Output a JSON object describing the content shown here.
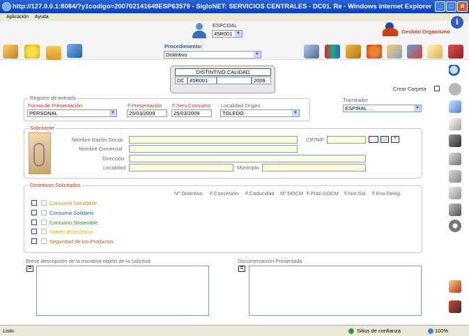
{
  "window": {
    "title": "http://127.0.0.1:8084/?y1codigo=200702141649ESP63579 - SigloNET: SERVICIOS CENTRALES - DC01. Re - Windows Internet Explorer",
    "min": "_",
    "max": "□",
    "close": "✕"
  },
  "menu": {
    "items": [
      {
        "label": "Aplicación"
      },
      {
        "label": "Ayuda"
      }
    ]
  },
  "header": {
    "user_label": "ESPCOAL",
    "user_select": "45R001",
    "procedimiento_label": "Procedimiento:",
    "procedimiento_value": "Distintivo",
    "brand": "Gestión Organismo",
    "help": "i"
  },
  "distintivo": {
    "title": "DISTINTIVO CALIDAD",
    "code1": "DC",
    "code2": "45R001",
    "code3": "",
    "code4": "2009"
  },
  "crear_carpeta": "Crear Carpeta",
  "registro": {
    "legend": "Registro de entrada",
    "forma_label": "Forma de Presentación",
    "forma_value": "PERSONAL",
    "fpres_label": "F.Presentación",
    "fpres_value": "25/03/2009",
    "fserv_label": "F.Serv.Consumo",
    "fserv_value": "25/03/2009",
    "loc_label": "Localidad Origen",
    "loc_value": "TOLEDO"
  },
  "tramitador": {
    "label": "Tramitador",
    "value": "ESPIRAL . ."
  },
  "solicitante": {
    "legend": "Solicitante",
    "nombre_label": "Nombre Razón Social",
    "cif_label": "CIF/NIF",
    "comercial_label": "Nombre Comercial",
    "direccion_label": "Dirección",
    "localidad_label": "Localidad",
    "municipio_label": "Municipio"
  },
  "distintivos": {
    "legend": "Distintivos Solicitados",
    "columns": [
      "Nº Distintivo",
      "F.Concesión",
      "F.Caducidad",
      "Nº DOCM",
      "F.Publ.DOCM",
      "F.Not.Sol.",
      "F.Env.Deleg."
    ],
    "items": [
      {
        "label": "Consumo Saludable",
        "color": "#d88a1a"
      },
      {
        "label": "Consumo Solidario",
        "color": "#1e5aa8"
      },
      {
        "label": "Consumo Sostenible",
        "color": "#2a8a2a"
      },
      {
        "label": "Interés Económico",
        "color": "#e0b000"
      },
      {
        "label": "Seguridad de los Productos",
        "color": "#c06020"
      }
    ]
  },
  "breve_label": "Breve descripción de la iniciativa objeto de la solicitud",
  "doc_label": "Documentación Presentada",
  "status": {
    "left": "Listo",
    "zone": "Sitios de confianza",
    "zoom": "100%"
  }
}
